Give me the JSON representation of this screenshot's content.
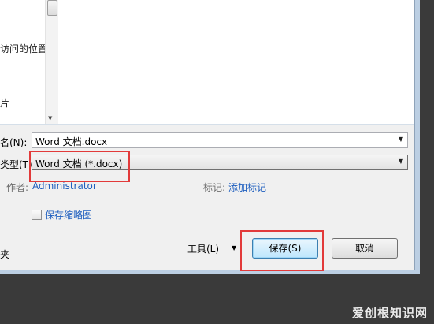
{
  "nav": {
    "items": [
      "访问的位置",
      "片"
    ]
  },
  "form": {
    "filename_label": "名(N):",
    "filename_value": "Word 文档.docx",
    "type_label": "类型(T):",
    "type_value": "Word 文档 (*.docx)",
    "author_label": "作者:",
    "author_value": "Administrator",
    "tags_label": "标记:",
    "tags_value": "添加标记",
    "thumbnail_label": "保存缩略图"
  },
  "footer": {
    "folder_label": "夹",
    "tools_label": "工具(L)",
    "save_label": "保存(S)",
    "cancel_label": "取消"
  },
  "watermark": "爱创根知识网",
  "colors": {
    "highlight": "#e23a3a",
    "link": "#1f5fbf"
  }
}
